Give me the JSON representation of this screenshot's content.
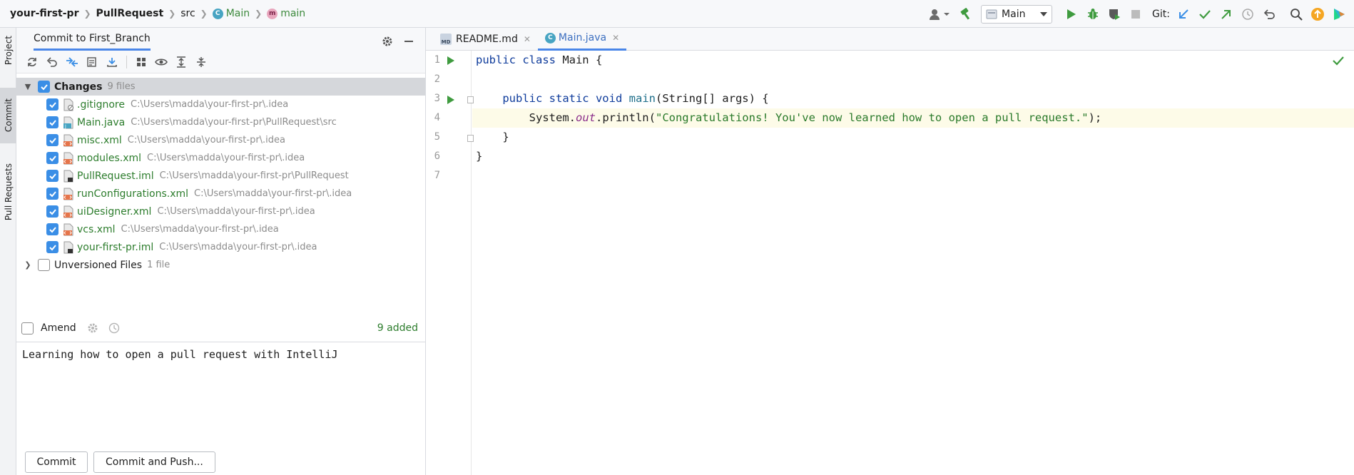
{
  "breadcrumbs": [
    {
      "label": "your-first-pr"
    },
    {
      "label": "PullRequest"
    },
    {
      "label": "src"
    },
    {
      "label": "Main",
      "icon": "C"
    },
    {
      "label": "main",
      "icon": "m"
    }
  ],
  "toolbar_right": {
    "run_config": "Main",
    "git_label": "Git:"
  },
  "left_strip": {
    "tabs": [
      {
        "label": "Project"
      },
      {
        "label": "Commit"
      },
      {
        "label": "Pull Requests"
      }
    ]
  },
  "commit_panel": {
    "title": "Commit to First_Branch",
    "changes": {
      "label": "Changes",
      "count": "9 files",
      "files": [
        {
          "name": ".gitignore",
          "path": "C:\\Users\\madda\\your-first-pr\\.idea"
        },
        {
          "name": "Main.java",
          "path": "C:\\Users\\madda\\your-first-pr\\PullRequest\\src"
        },
        {
          "name": "misc.xml",
          "path": "C:\\Users\\madda\\your-first-pr\\.idea"
        },
        {
          "name": "modules.xml",
          "path": "C:\\Users\\madda\\your-first-pr\\.idea"
        },
        {
          "name": "PullRequest.iml",
          "path": "C:\\Users\\madda\\your-first-pr\\PullRequest"
        },
        {
          "name": "runConfigurations.xml",
          "path": "C:\\Users\\madda\\your-first-pr\\.idea"
        },
        {
          "name": "uiDesigner.xml",
          "path": "C:\\Users\\madda\\your-first-pr\\.idea"
        },
        {
          "name": "vcs.xml",
          "path": "C:\\Users\\madda\\your-first-pr\\.idea"
        },
        {
          "name": "your-first-pr.iml",
          "path": "C:\\Users\\madda\\your-first-pr\\.idea"
        }
      ]
    },
    "unversioned": {
      "label": "Unversioned Files",
      "count": "1 file"
    },
    "amend_label": "Amend",
    "added_status": "9 added",
    "message": "Learning how to open a pull request with IntelliJ",
    "commit_button": "Commit",
    "commit_push_button": "Commit and Push..."
  },
  "editor": {
    "tabs": [
      {
        "label": "README.md",
        "icon": "MD"
      },
      {
        "label": "Main.java",
        "icon": "C"
      }
    ],
    "line_numbers": [
      "1",
      "2",
      "3",
      "4",
      "5",
      "6",
      "7"
    ],
    "code": {
      "l1_kw": "public class",
      "l1_rest": " Main {",
      "l3_kw": "public static void",
      "l3_fn": "main",
      "l3_rest": "(String[] args) {",
      "l4_a": "System.",
      "l4_out": "out",
      "l4_b": ".println(",
      "l4_str": "\"Congratulations! You've now learned how to open a pull request.\"",
      "l4_c": ");",
      "l5": "}",
      "l6": "}"
    }
  },
  "colors": {
    "accent": "#4a86e8",
    "checkbox": "#3a8ee6",
    "file_added": "#2d7d2d",
    "run_green": "#3f9b3f"
  }
}
